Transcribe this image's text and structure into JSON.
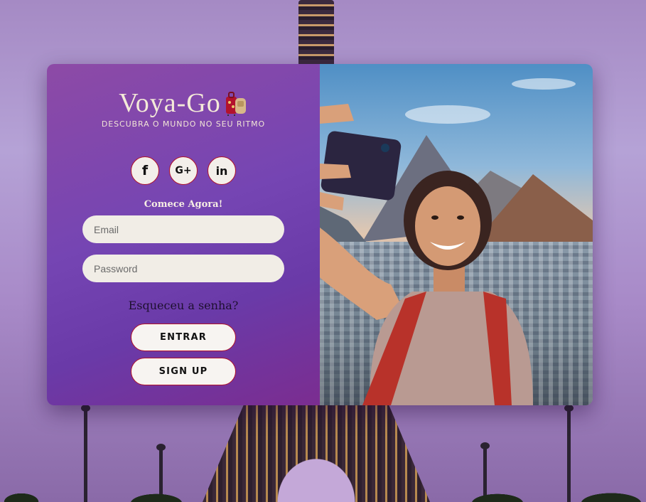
{
  "brand": {
    "name": "Voya-Go",
    "tagline": "DESCUBRA O MUNDO NO SEU RITMO"
  },
  "social": [
    {
      "icon": "facebook-icon",
      "glyph": "f"
    },
    {
      "icon": "google-plus-icon",
      "glyph": "G+"
    },
    {
      "icon": "linkedin-icon",
      "glyph": "in"
    }
  ],
  "form": {
    "cta": "Comece Agora!",
    "email_placeholder": "Email",
    "password_placeholder": "Password",
    "forgot_label": "Esqueceu a senha?",
    "enter_label": "ENTRAR",
    "signup_label": "SIGN UP"
  },
  "colors": {
    "panel_start": "#8d4aa6",
    "panel_end": "#7b2d90",
    "button_border": "#b0122a",
    "input_bg": "#f1ede6"
  }
}
